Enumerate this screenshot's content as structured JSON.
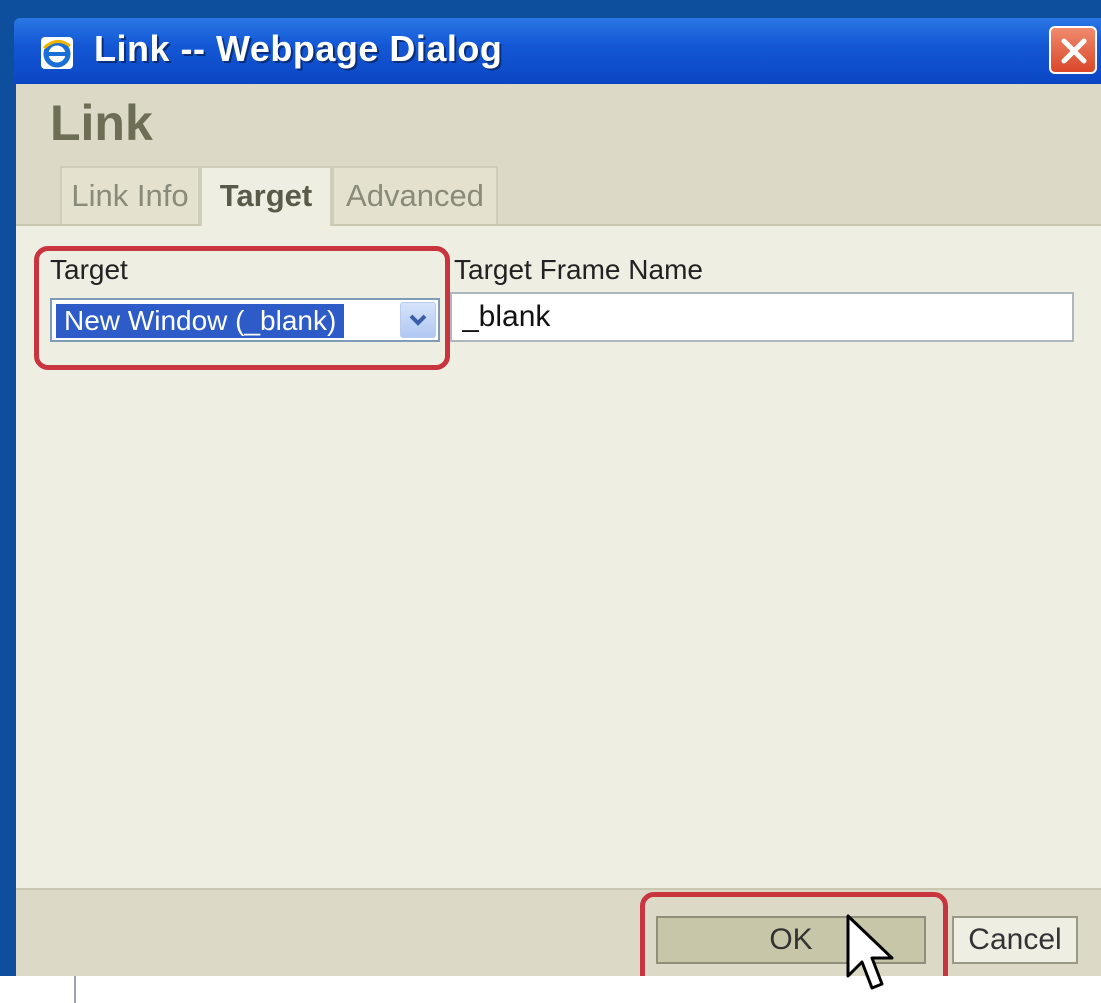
{
  "window": {
    "title": "Link -- Webpage Dialog",
    "icon": "ie-icon",
    "close_icon": "close-icon"
  },
  "dialog": {
    "heading": "Link",
    "tabs": [
      {
        "label": "Link Info",
        "active": false
      },
      {
        "label": "Target",
        "active": true
      },
      {
        "label": "Advanced",
        "active": false
      }
    ]
  },
  "form": {
    "target_label": "Target",
    "target_select_value": "New Window (_blank)",
    "frame_name_label": "Target Frame Name",
    "frame_name_value": "_blank"
  },
  "footer": {
    "ok_label": "OK",
    "cancel_label": "Cancel"
  },
  "colors": {
    "highlight": "#c8353f",
    "titlebar": "#1458d6",
    "selection": "#2d5bc8"
  }
}
